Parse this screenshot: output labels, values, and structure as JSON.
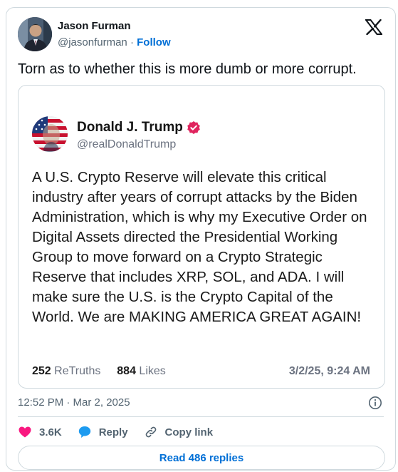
{
  "author": {
    "name": "Jason Furman",
    "handle": "@jasonfurman",
    "separator": "·",
    "follow_label": "Follow",
    "avatar_icon": "person-avatar"
  },
  "platform_icon": "x-logo-icon",
  "tweet": {
    "text": "Torn as to whether this is more dumb or more corrupt."
  },
  "quoted_post": {
    "name": "Donald J. Trump",
    "handle": "@realDonaldTrump",
    "verified_color": "#e0245e",
    "body": "A U.S. Crypto Reserve will elevate this critical industry after years of corrupt attacks by the Biden Administration, which is why my Executive Order on Digital Assets directed the Presidential Working Group to move forward on a Crypto Strategic Reserve that includes XRP, SOL, and ADA. I will make sure the U.S. is the Crypto Capital of the World. We are MAKING AMERICA GREAT AGAIN!",
    "retruths_count": "252",
    "retruths_label": "ReTruths",
    "likes_count": "884",
    "likes_label": "Likes",
    "date": "3/2/25, 9:24 AM"
  },
  "timestamp": "12:52 PM · Mar 2, 2025",
  "actions": {
    "like_count": "3.6K",
    "reply_label": "Reply",
    "copy_link_label": "Copy link"
  },
  "read_replies_label": "Read 486 replies",
  "colors": {
    "link_blue": "#006fd6",
    "like_pink": "#f91880",
    "reply_blue": "#1d9bf0",
    "border": "#cfd9de",
    "secondary_text": "#536471"
  }
}
